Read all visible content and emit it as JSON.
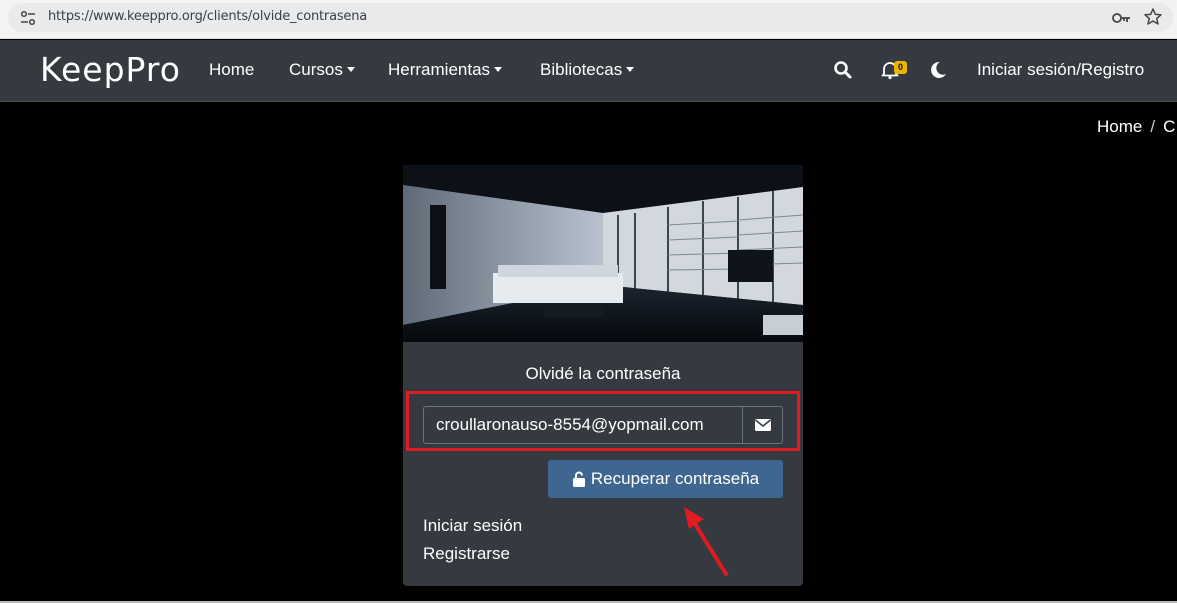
{
  "browser": {
    "url": "https://www.keeppro.org/clients/olvide_contrasena"
  },
  "navbar": {
    "brand": "KeepPro",
    "items": [
      {
        "label": "Home"
      },
      {
        "label": "Cursos"
      },
      {
        "label": "Herramientas"
      },
      {
        "label": "Bibliotecas"
      }
    ],
    "notifications_count": "0",
    "login_register": "Iniciar sesión/Registro"
  },
  "breadcrumb": {
    "home": "Home",
    "sep": "/",
    "current": "C"
  },
  "card": {
    "title": "Olvidé la contraseña",
    "email_value": "croullaronauso-8554@yopmail.com",
    "recover_button": "Recuperar contraseña",
    "login_link": "Iniciar sesión",
    "register_link": "Registrarse"
  },
  "colors": {
    "navbar": "#343a40",
    "button": "#3f6690",
    "highlight": "#e11b22",
    "badge": "#f0b400"
  }
}
